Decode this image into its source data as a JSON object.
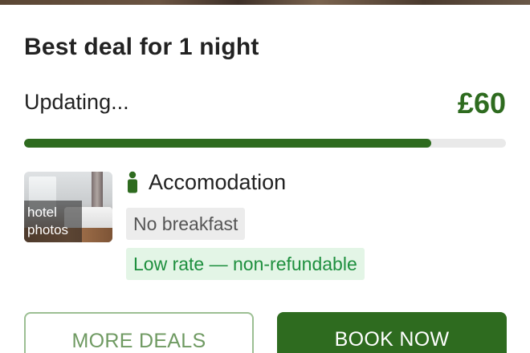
{
  "deal": {
    "title": "Best deal for 1 night",
    "status": "Updating...",
    "price": "£60",
    "progress": 0.845
  },
  "room": {
    "thumb_label": "hotel photos",
    "icon": "person-icon",
    "type_label": "Accomodation",
    "badges": {
      "meal": "No breakfast",
      "rate": "Low rate — non-refundable"
    }
  },
  "actions": {
    "more_deals": "MORE DEALS",
    "book_now": "BOOK NOW"
  },
  "colors": {
    "brand_green": "#2e6b1f",
    "rate_green": "#1e8f3e",
    "rate_bg": "#e3f5e6",
    "outline": "#9cbf93"
  }
}
